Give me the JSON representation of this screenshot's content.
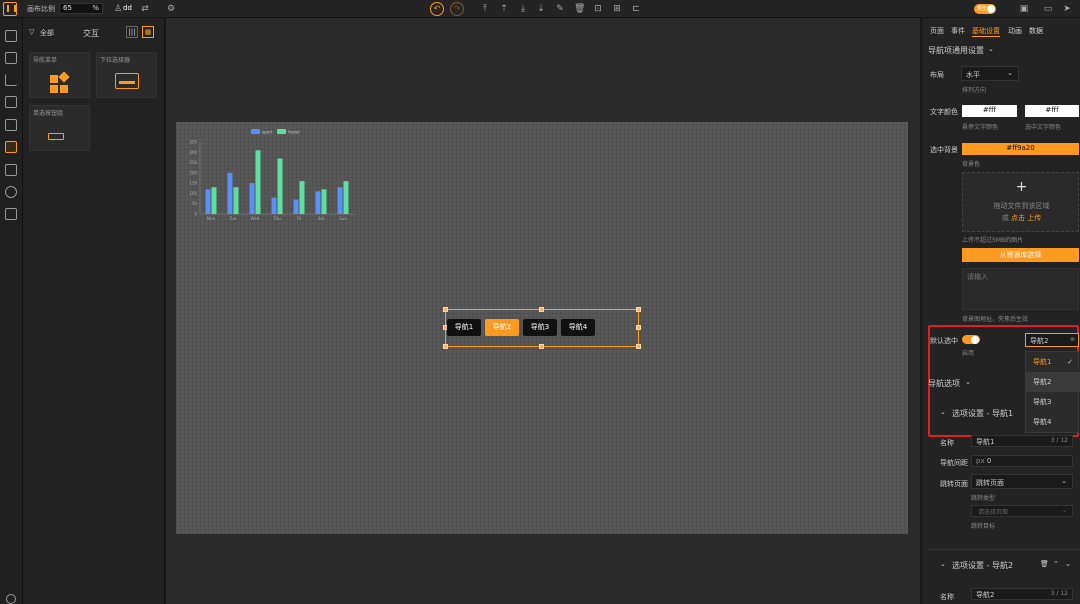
{
  "toolbar": {
    "scale_label": "画布比例",
    "scale_value": "65",
    "scale_unit": "%",
    "user": "dd",
    "preview_label": "预览"
  },
  "components": {
    "filters": {
      "all": "全部",
      "interact": "交互"
    },
    "cards": [
      "导航菜单",
      "下拉选择器",
      "单选按钮组"
    ]
  },
  "chart_data": {
    "type": "bar",
    "categories": [
      "Mon",
      "Tue",
      "Wed",
      "Thu",
      "Fri",
      "Sat",
      "Sun"
    ],
    "series": [
      {
        "name": "sport",
        "values": [
          120,
          200,
          150,
          80,
          70,
          110,
          130
        ]
      },
      {
        "name": "travel",
        "values": [
          130,
          130,
          310,
          270,
          160,
          120,
          160
        ]
      }
    ],
    "ylim": [
      0,
      350
    ],
    "yticks": [
      "0",
      "50",
      "100",
      "150",
      "200",
      "250",
      "300",
      "350"
    ],
    "colors": [
      "#5b8ff9",
      "#5ce0a0"
    ],
    "legend": "top"
  },
  "nav": {
    "items": [
      "导航1",
      "导航2",
      "导航3",
      "导航4"
    ],
    "selected_index": 1,
    "accent": "#ff9a20"
  },
  "panel": {
    "tabs": [
      "页面",
      "事件",
      "基础设置",
      "动画",
      "数据"
    ],
    "section_general": "导航项通用设置",
    "layout_label": "布局",
    "layout_value": "水平",
    "layout_hint": "排列方向",
    "text_color_label": "文字颜色",
    "text_color_hover": "#fff",
    "text_color_selected": "#fff",
    "hover_hint": "悬停文字颜色",
    "selected_hint": "选中文字颜色",
    "bg_label": "选中背景",
    "bg_value": "#ff9a20",
    "bg_hint": "背景色",
    "upload_plus": "+",
    "upload_line1": "拖动文件到该区域",
    "upload_or": "或 ",
    "upload_link": "点击 上传",
    "upload_limit": "上传不超过5MB的图片",
    "choose_lib": "从资源库选择",
    "textarea_placeholder": "请输入",
    "textarea_hint": "背景图地址，失焦后生效",
    "default_label": "默认选中",
    "enabled_hint": "启用",
    "default_value": "导航2",
    "dropdown": [
      "导航1",
      "导航2",
      "导航3",
      "导航4"
    ],
    "nav_options_label": "导航选项",
    "opt1_title": "选项设置 - 导航1",
    "name_label": "名称",
    "name1": "导航1",
    "count1": "3 / 12",
    "spacing_label": "导航间距",
    "spacing_unit": "px",
    "spacing_value": "0",
    "jump_label": "跳转页面",
    "jump_value": "跳转页面",
    "jump_hint": "跳转类型",
    "jump_select_placeholder": "请选择页面",
    "jump_target_hint": "跳转目标",
    "opt2_title": "选项设置 - 导航2",
    "name2": "导航2",
    "count2": "3 / 12"
  }
}
